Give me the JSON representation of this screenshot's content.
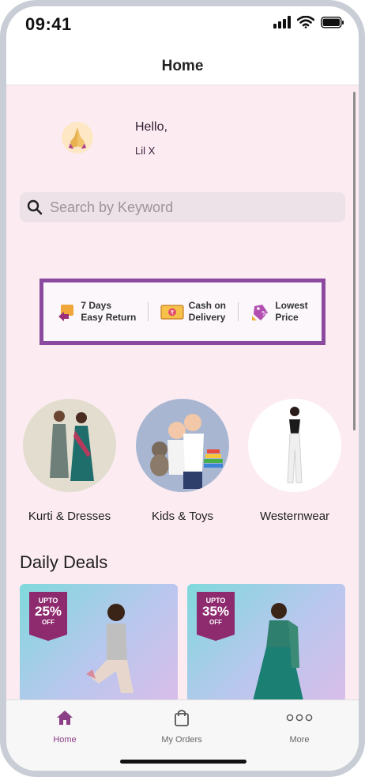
{
  "status_bar": {
    "time": "09:41"
  },
  "header": {
    "title": "Home"
  },
  "greeting": {
    "hello": "Hello,",
    "name": "Lil X"
  },
  "search": {
    "placeholder": "Search by Keyword"
  },
  "promo": {
    "items": [
      {
        "line1": "7 Days",
        "line2": "Easy Return",
        "icon": "box-return-icon"
      },
      {
        "line1": "Cash on",
        "line2": "Delivery",
        "icon": "cash-icon"
      },
      {
        "line1": "Lowest",
        "line2": "Price",
        "icon": "price-tag-icon"
      }
    ],
    "border_color": "#8b4aa0"
  },
  "categories": [
    {
      "label": "Kurti & Dresses"
    },
    {
      "label": "Kids & Toys"
    },
    {
      "label": "Westernwear"
    }
  ],
  "daily_deals": {
    "title": "Daily Deals",
    "cards": [
      {
        "badge_top": "UPTO",
        "badge_value": "25%",
        "badge_bottom": "OFF"
      },
      {
        "badge_top": "UPTO",
        "badge_value": "35%",
        "badge_bottom": "OFF"
      }
    ]
  },
  "tab_bar": {
    "tabs": [
      {
        "label": "Home",
        "icon": "home-icon",
        "active": true
      },
      {
        "label": "My Orders",
        "icon": "shopping-bag-icon",
        "active": false
      },
      {
        "label": "More",
        "icon": "more-dots-icon",
        "active": false
      }
    ],
    "active_color": "#8b3f86"
  },
  "colors": {
    "content_background": "#fcecf2",
    "accent": "#8b4aa0"
  }
}
